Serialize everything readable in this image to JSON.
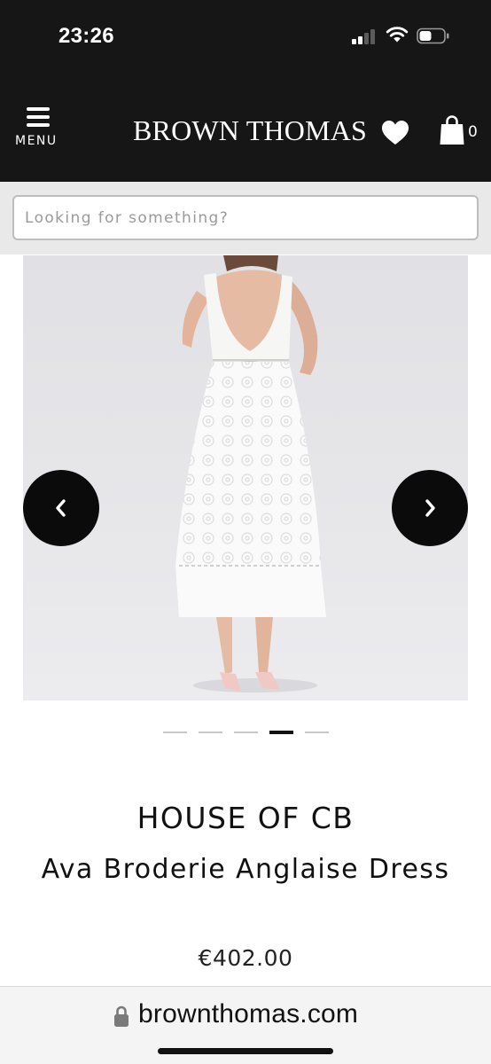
{
  "status_bar": {
    "time": "23:26",
    "icons": [
      "signal-icon",
      "wifi-icon",
      "battery-icon"
    ]
  },
  "header": {
    "menu_label": "MENU",
    "brand_logo": "BROWN THOMAS",
    "wishlist_icon": "heart-icon",
    "bag_icon": "shopping-bag-icon",
    "bag_count": "0",
    "background": "#161616"
  },
  "search": {
    "placeholder": "Looking for something?",
    "value": ""
  },
  "gallery": {
    "image": "product-photo-white-dress-back-view",
    "prev_icon": "chevron-left-icon",
    "next_icon": "chevron-right-icon",
    "total_slides": 5,
    "active_slide": 4
  },
  "product": {
    "brand": "HOUSE OF CB",
    "name": "Ava Broderie Anglaise Dress",
    "price": "€402.00"
  },
  "url_bar": {
    "lock_icon": "lock-icon",
    "domain": "brownthomas.com"
  }
}
